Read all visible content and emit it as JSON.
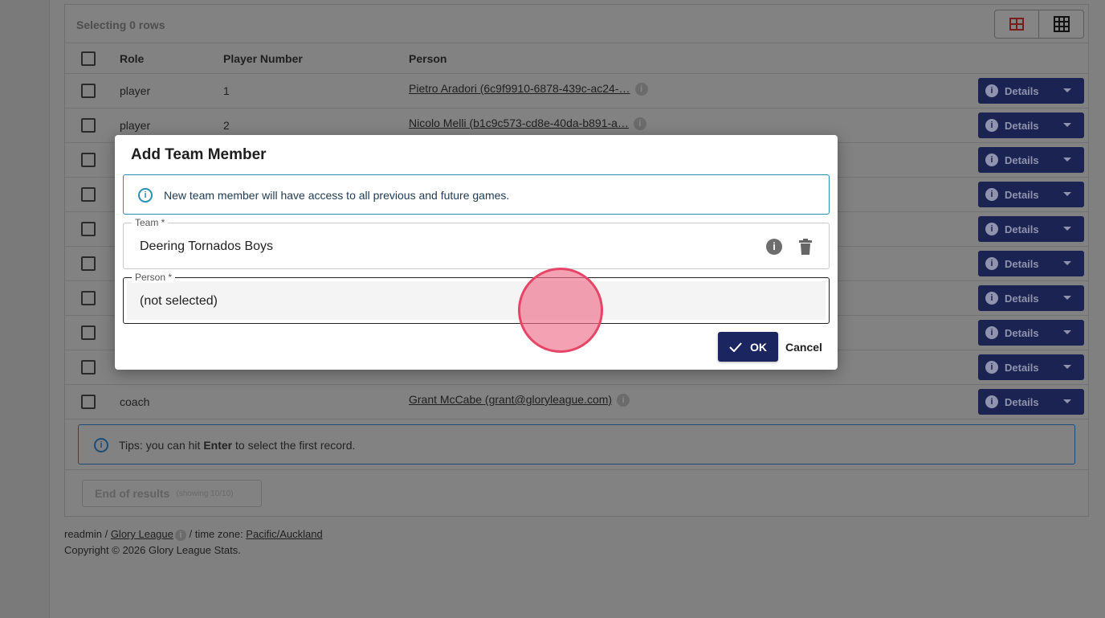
{
  "table": {
    "selecting": "Selecting 0 rows",
    "headers": {
      "role": "Role",
      "player_number": "Player Number",
      "person": "Person"
    },
    "rows": [
      {
        "role": "player",
        "number": "1",
        "person": "Pietro Aradori (6c9f9910-6878-439c-ac24-…"
      },
      {
        "role": "player",
        "number": "2",
        "person": "Nicolo Melli (b1c9c573-cd8e-40da-b891-a…"
      },
      {
        "role": "",
        "number": "",
        "person": ""
      },
      {
        "role": "",
        "number": "",
        "person": ""
      },
      {
        "role": "",
        "number": "",
        "person": ""
      },
      {
        "role": "",
        "number": "",
        "person": ""
      },
      {
        "role": "",
        "number": "",
        "person": ""
      },
      {
        "role": "",
        "number": "",
        "person": ""
      },
      {
        "role": "",
        "number": "",
        "person": ""
      },
      {
        "role": "coach",
        "number": "",
        "person": "Grant McCabe (grant@gloryleague.com)"
      }
    ],
    "details_label": "Details",
    "info_glyph": "i"
  },
  "tips": {
    "prefix": "Tips: you can hit ",
    "key": "Enter",
    "suffix": " to select the first record."
  },
  "pagination": {
    "end_label": "End of results",
    "showing": "(showing 10/10)"
  },
  "footer": {
    "user": "readmin / ",
    "org": "Glory League",
    "tz_prefix": " / time zone: ",
    "tz": "Pacific/Auckland",
    "copyright": "Copyright © 2026 Glory League Stats."
  },
  "modal": {
    "title": "Add Team Member",
    "alert": "New team member will have access to all previous and future games.",
    "team_label": "Team *",
    "team_value": "Deering Tornados Boys",
    "person_label": "Person *",
    "person_value": "(not selected)",
    "ok_label": "OK",
    "cancel_label": "Cancel"
  },
  "colors": {
    "primary": "#1b2660",
    "info": "#2b8fb0",
    "cursor": "#e64567"
  }
}
